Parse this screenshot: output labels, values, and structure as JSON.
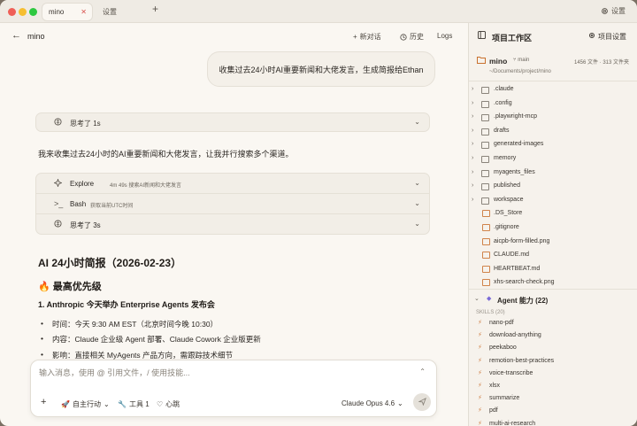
{
  "titlebar": {
    "tabs": [
      {
        "label": "mino",
        "active": true
      },
      {
        "label": "设置",
        "active": false
      }
    ],
    "add_tab": "+",
    "settings_label": "设置"
  },
  "main": {
    "chat_title": "mino",
    "header_buttons": {
      "new_chat": "新对话",
      "history": "历史",
      "logs": "Logs"
    },
    "user_message": "收集过去24小时AI重要新闻和大佬发言，生成简报给Ethan",
    "think_1": "思考了 1s",
    "assistant_text": "我来收集过去24小时的AI重要新闻和大佬发言，让我并行搜索多个渠道。",
    "tools": [
      {
        "name": "Explore",
        "meta": "4m 49s  搜索AI新闻和大佬发言",
        "icon": "sparkle-icon"
      },
      {
        "name": "Bash",
        "meta": "获取当前UTC时间",
        "icon": "terminal-icon"
      },
      {
        "name": "思考了 3s",
        "meta": "",
        "icon": "brain-icon"
      }
    ],
    "report": {
      "title": "AI 24小时简报（2026-02-23）",
      "section": "🔥 最高优先级",
      "item_title": "1. Anthropic 今天举办 Enterprise Agents 发布会",
      "bullets": [
        "时间：今天 9:30 AM EST（北京时间今晚 10:30）",
        "内容：Claude 企业级 Agent 部署、Claude Cowork 企业版更新",
        "影响：直接相关 MyAgents 产品方向，需跟踪技术细节"
      ]
    },
    "composer": {
      "placeholder": "输入消息，使用 @ 引用文件，/ 使用技能...",
      "value": "",
      "auto_mode": "自主行动",
      "tools": "工具 1",
      "heartbeat": "心跳",
      "model": "Claude Opus 4.6"
    }
  },
  "side": {
    "title": "项目工作区",
    "settings": "项目设置",
    "project": {
      "name": "mino",
      "branch": "main",
      "files": "1456 文件 · 313 文件夹",
      "path": "~/Documents/project/mino"
    },
    "tree": [
      {
        "name": ".claude",
        "type": "folder"
      },
      {
        "name": ".config",
        "type": "folder"
      },
      {
        "name": ".playwright-mcp",
        "type": "folder"
      },
      {
        "name": "drafts",
        "type": "folder"
      },
      {
        "name": "generated-images",
        "type": "folder"
      },
      {
        "name": "memory",
        "type": "folder"
      },
      {
        "name": "myagents_files",
        "type": "folder"
      },
      {
        "name": "published",
        "type": "folder"
      },
      {
        "name": "workspace",
        "type": "folder"
      },
      {
        "name": ".DS_Store",
        "type": "file"
      },
      {
        "name": ".gitignore",
        "type": "file"
      },
      {
        "name": "aicpb-form-filled.png",
        "type": "file"
      },
      {
        "name": "CLAUDE.md",
        "type": "file"
      },
      {
        "name": "HEARTBEAT.md",
        "type": "file"
      },
      {
        "name": "xhs-search-check.png",
        "type": "file"
      }
    ],
    "agent": {
      "title": "Agent 能力 (22)",
      "skills_label": "SKILLS (20)",
      "skills": [
        "nano-pdf",
        "download-anything",
        "peekaboo",
        "remotion-best-practices",
        "voice-transcribe",
        "xlsx",
        "summarize",
        "pdf",
        "multi-ai-research"
      ]
    }
  },
  "colors": {
    "background": "#faf7f2",
    "sidebar": "#f6f2ec",
    "accent": "#d0834a",
    "close_red": "#ef5f57",
    "minimize_yellow": "#f6be30",
    "zoom_green": "#2dc840"
  }
}
